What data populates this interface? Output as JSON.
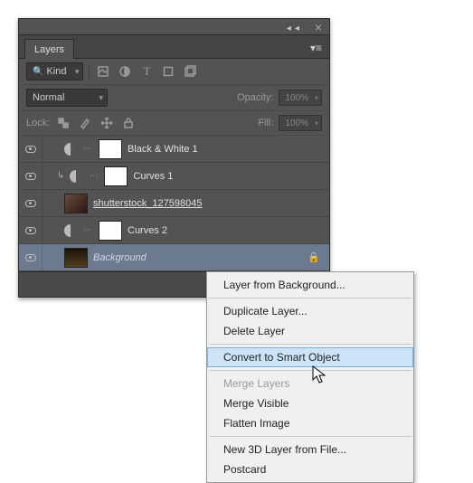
{
  "panel": {
    "tab": "Layers",
    "filter": {
      "kind_search_icon": "🔍",
      "kind_label": "Kind"
    },
    "blend": {
      "mode": "Normal",
      "opacity_label": "Opacity:",
      "opacity_value": "100%"
    },
    "lock": {
      "label": "Lock:",
      "fill_label": "Fill:",
      "fill_value": "100%"
    },
    "layers": [
      {
        "name": "Black & White 1",
        "type": "adjustment",
        "clipped": false
      },
      {
        "name": "Curves 1",
        "type": "adjustment",
        "clipped": true
      },
      {
        "name": "shutterstock_127598045",
        "type": "image",
        "underlined": true
      },
      {
        "name": "Curves 2",
        "type": "adjustment",
        "clipped": false
      },
      {
        "name": "Background",
        "type": "bg",
        "italic": true,
        "locked": true,
        "selected": true
      }
    ]
  },
  "contextmenu": {
    "items": [
      {
        "label": "Layer from Background...",
        "enabled": true
      },
      {
        "sep": true
      },
      {
        "label": "Duplicate Layer...",
        "enabled": true
      },
      {
        "label": "Delete Layer",
        "enabled": true
      },
      {
        "sep": true
      },
      {
        "label": "Convert to Smart Object",
        "enabled": true,
        "hover": true
      },
      {
        "sep": true
      },
      {
        "label": "Merge Layers",
        "enabled": false
      },
      {
        "label": "Merge Visible",
        "enabled": true
      },
      {
        "label": "Flatten Image",
        "enabled": true
      },
      {
        "sep": true
      },
      {
        "label": "New 3D Layer from File...",
        "enabled": true
      },
      {
        "label": "Postcard",
        "enabled": true
      }
    ]
  }
}
